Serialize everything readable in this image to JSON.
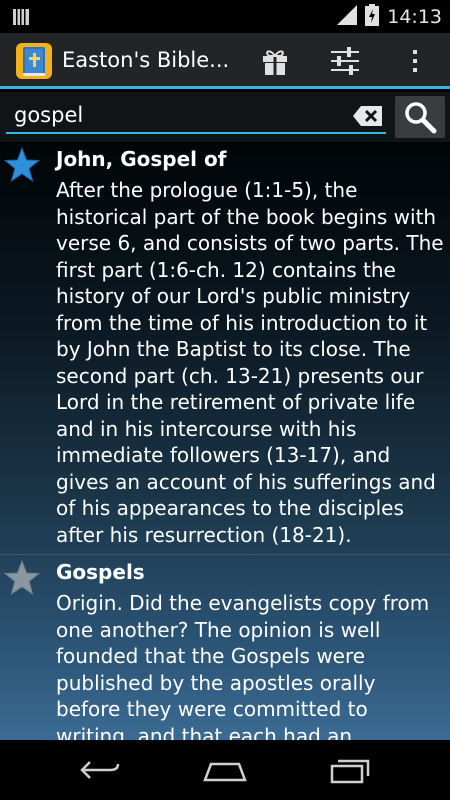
{
  "status": {
    "time": "14:13"
  },
  "actionbar": {
    "title": "Easton's Bible...",
    "icons": [
      "app-book-icon",
      "gift-icon",
      "sliders-icon",
      "overflow-menu-icon"
    ]
  },
  "search": {
    "value": "gospel",
    "placeholder": ""
  },
  "entries": [
    {
      "title": "John, Gospel of",
      "starred": true,
      "body": "After the prologue (1:1-5), the historical part of the book begins with verse 6, and consists of two parts. The first part (1:6-ch. 12) contains the history of our Lord's public ministry from the time of his introduction to it by John the Baptist to its close. The second part (ch. 13-21) presents our Lord in the retirement of private life and in his intercourse with his immediate followers (13-17), and gives an account of his sufferings and of his appearances to the disciples after his resurrection (18-21)."
    },
    {
      "title": "Gospels",
      "starred": false,
      "body": "Origin. Did the evangelists copy from one another? The opinion is well founded that the Gospels were published by the apostles orally before they were committed to writing, and that each had an independent origin."
    }
  ],
  "colors": {
    "accent": "#33b5e5",
    "star_active": "#2f8fd8",
    "star_inactive": "#8a96a0"
  }
}
